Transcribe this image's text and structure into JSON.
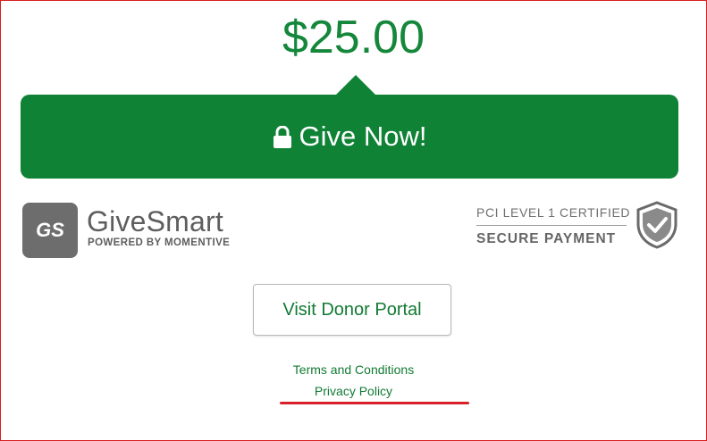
{
  "donation": {
    "amount": "$25.00"
  },
  "give_button": {
    "label": "Give Now!",
    "icon": "lock-icon"
  },
  "brand": {
    "logo_text": "GS",
    "name": "GiveSmart",
    "tagline": "POWERED BY MOMENTIVE"
  },
  "security_badge": {
    "line1": "PCI LEVEL 1 CERTIFIED",
    "line2": "SECURE PAYMENT",
    "icon": "shield-check-icon"
  },
  "portal": {
    "label": "Visit Donor Portal"
  },
  "footer": {
    "terms": "Terms and Conditions",
    "privacy": "Privacy Policy"
  },
  "colors": {
    "accent_green": "#0f8235",
    "text_green": "#117a33",
    "border_red": "#d81e1e",
    "annotation_red": "#d9202a",
    "logo_gray": "#6d6d6d"
  }
}
